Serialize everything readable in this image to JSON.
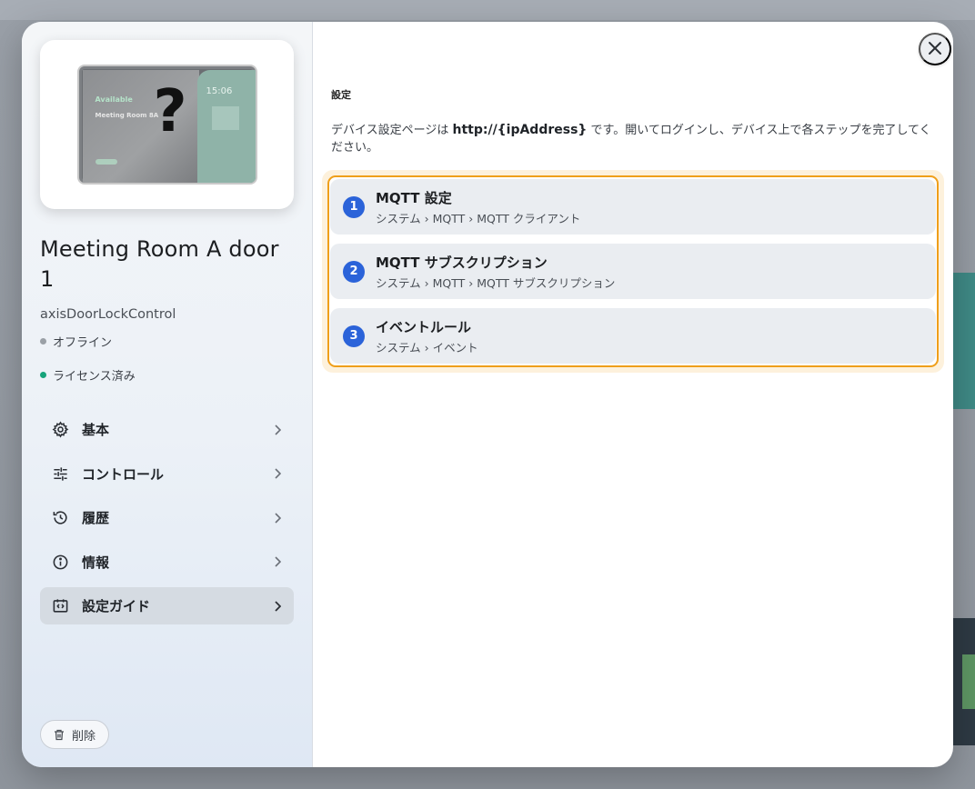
{
  "device": {
    "name": "Meeting Room A door 1",
    "type": "axisDoorLockControl",
    "image": {
      "placeholder_glyph": "?",
      "screen_status": "Available",
      "screen_room": "Meeting Room 8A",
      "screen_time": "15:06"
    },
    "statuses": [
      {
        "label": "オフライン",
        "color": "#9aa0a6"
      },
      {
        "label": "ライセンス済み",
        "color": "#16a37a"
      }
    ]
  },
  "nav": {
    "items": [
      {
        "label": "基本",
        "icon": "gear-icon"
      },
      {
        "label": "コントロール",
        "icon": "sliders-icon"
      },
      {
        "label": "履歴",
        "icon": "history-icon"
      },
      {
        "label": "情報",
        "icon": "info-icon"
      },
      {
        "label": "設定ガイド",
        "icon": "setup-guide-icon",
        "active": true
      }
    ]
  },
  "delete": {
    "label": "削除"
  },
  "main": {
    "section_title": "設定",
    "description_prefix": "デバイス設定ページは ",
    "description_url": "http://{ipAddress}",
    "description_suffix": " です。開いてログインし、デバイス上で各ステップを完了してください。",
    "steps": [
      {
        "number": "1",
        "title": "MQTT 設定",
        "path": "システム › MQTT › MQTT クライアント"
      },
      {
        "number": "2",
        "title": "MQTT サブスクリプション",
        "path": "システム › MQTT › MQTT サブスクリプション"
      },
      {
        "number": "3",
        "title": "イベントルール",
        "path": "システム › イベント"
      }
    ]
  },
  "colors": {
    "accent": "#2b63d9",
    "highlight_border": "#ef9f1b",
    "online_dot": "#16a37a",
    "offline_dot": "#9aa0a6"
  }
}
